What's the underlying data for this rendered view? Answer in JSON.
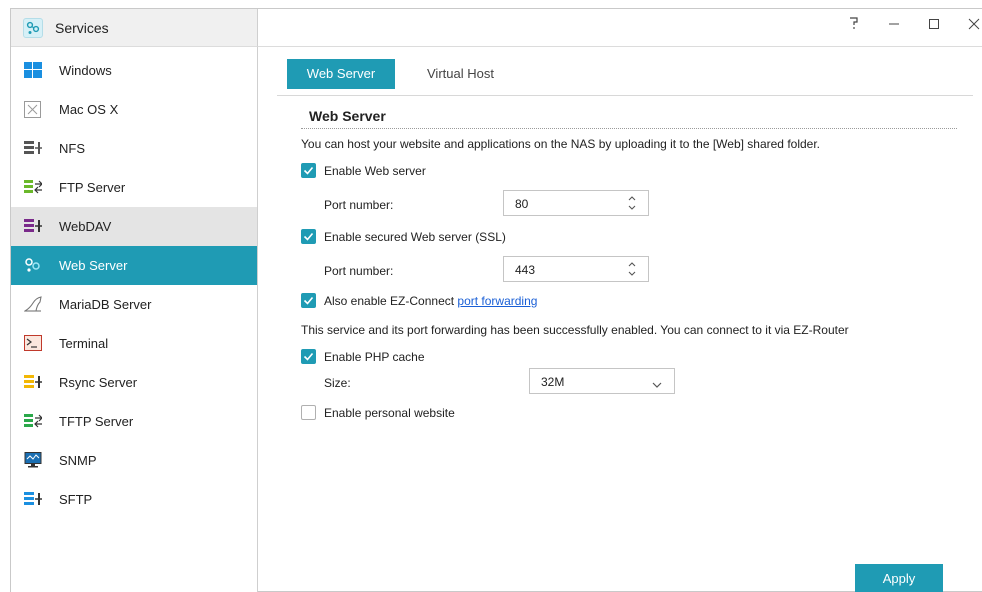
{
  "window": {
    "title": "Services",
    "controls": {
      "help": "?",
      "minimize": "—",
      "maximize": "☐",
      "close": "✕"
    }
  },
  "sidebar": {
    "items": [
      {
        "label": "Windows",
        "icon": "windows-icon"
      },
      {
        "label": "Mac OS X",
        "icon": "macos-icon"
      },
      {
        "label": "NFS",
        "icon": "nfs-icon"
      },
      {
        "label": "FTP Server",
        "icon": "ftp-icon"
      },
      {
        "label": "WebDAV",
        "icon": "webdav-icon",
        "state": "hover"
      },
      {
        "label": "Web Server",
        "icon": "web-server-icon",
        "state": "selected"
      },
      {
        "label": "MariaDB Server",
        "icon": "mariadb-icon"
      },
      {
        "label": "Terminal",
        "icon": "terminal-icon"
      },
      {
        "label": "Rsync Server",
        "icon": "rsync-icon"
      },
      {
        "label": "TFTP Server",
        "icon": "tftp-icon"
      },
      {
        "label": "SNMP",
        "icon": "snmp-icon"
      },
      {
        "label": "SFTP",
        "icon": "sftp-icon"
      }
    ]
  },
  "tabs": {
    "active": "Web Server",
    "other": "Virtual Host"
  },
  "content": {
    "section_title": "Web Server",
    "description": "You can host your website and applications on the NAS by uploading it to the [Web] shared folder.",
    "enable_web": {
      "label": "Enable Web server",
      "checked": true
    },
    "port_label_1": "Port number:",
    "port_value_1": "80",
    "enable_ssl": {
      "label": "Enable secured Web server (SSL)",
      "checked": true
    },
    "port_label_2": "Port number:",
    "port_value_2": "443",
    "ez_connect": {
      "label": "Also enable EZ-Connect ",
      "link": "port forwarding",
      "checked": true
    },
    "status_text": "This service and its port forwarding has been successfully enabled. You can connect to it via EZ-Router",
    "php_cache": {
      "label": "Enable PHP cache",
      "checked": true
    },
    "size_label": "Size:",
    "size_value": "32M",
    "personal_site": {
      "label": "Enable personal website",
      "checked": false
    },
    "apply_label": "Apply"
  },
  "colors": {
    "accent": "#1f9bb4",
    "link": "#1a5fd6",
    "hover": "#e4e4e4"
  }
}
